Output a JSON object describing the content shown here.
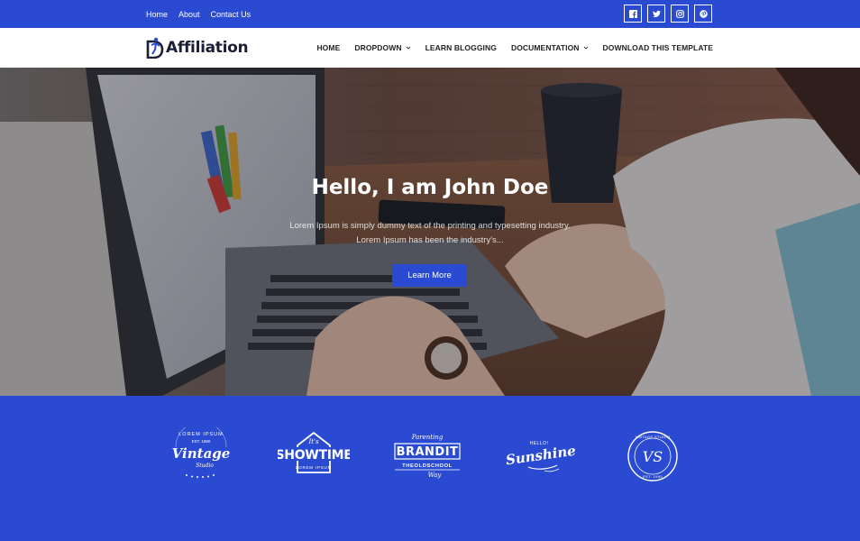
{
  "topbar": {
    "links": [
      "Home",
      "About",
      "Contact Us"
    ],
    "social": [
      {
        "icon": "facebook-icon"
      },
      {
        "icon": "twitter-icon"
      },
      {
        "icon": "instagram-icon"
      },
      {
        "icon": "pinterest-icon"
      }
    ]
  },
  "header": {
    "logo_text": "Affiliation",
    "nav": [
      {
        "label": "HOME",
        "dropdown": false
      },
      {
        "label": "DROPDOWN",
        "dropdown": true
      },
      {
        "label": "LEARN BLOGGING",
        "dropdown": false
      },
      {
        "label": "DOCUMENTATION",
        "dropdown": true
      },
      {
        "label": "DOWNLOAD THIS TEMPLATE",
        "dropdown": false
      }
    ]
  },
  "hero": {
    "title": "Hello, I am John Doe",
    "description": "Lorem Ipsum is simply dummy text of the printing and typesetting industry. Lorem Ipsum has been the industry's...",
    "button_label": "Learn More"
  },
  "brands": {
    "vintage": {
      "top": "LOREM IPSUM",
      "sub": "EST. 1990",
      "main": "Vintage",
      "foot": "Studio"
    },
    "showtime": {
      "top": "It's",
      "main": "SHOWTIME",
      "foot": "LOREM IPSUM"
    },
    "brandit": {
      "top": "Parenting",
      "main": "BRANDIT",
      "sub": "THEOLDSCHOOL",
      "foot": "Way"
    },
    "sunshine": {
      "top": "HELLO!",
      "main": "Sunshine"
    },
    "vs": {
      "top": "VINTAGE STUDIO",
      "main": "VS",
      "foot": "EST. 1990"
    }
  },
  "colors": {
    "brand_blue": "#2a4bd1",
    "white": "#ffffff",
    "dark_text": "#1b1f36"
  }
}
